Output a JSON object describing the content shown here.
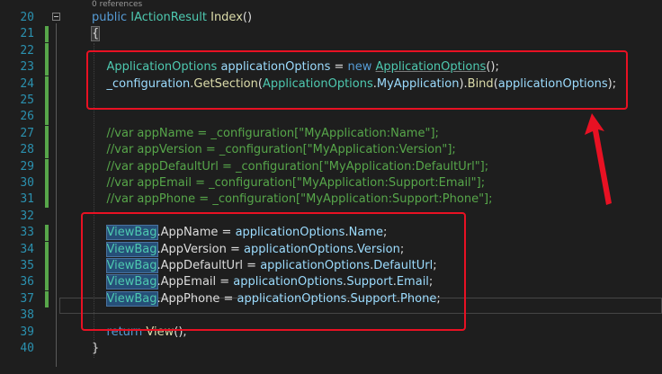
{
  "refs": "0 references",
  "lines": [
    {
      "n": "20",
      "parts": [
        [
          "kw",
          "public "
        ],
        [
          "ty",
          "IActionResult "
        ],
        [
          "fn",
          "Index"
        ],
        [
          "plain",
          "()"
        ]
      ]
    },
    {
      "n": "21",
      "parts": [
        [
          "brace",
          "{"
        ]
      ]
    },
    {
      "n": "22",
      "parts": []
    },
    {
      "n": "23",
      "parts": [
        [
          "plain",
          "    "
        ],
        [
          "ty",
          "ApplicationOptions "
        ],
        [
          "var",
          "applicationOptions"
        ],
        [
          "plain",
          " = "
        ],
        [
          "kw",
          "new "
        ],
        [
          "tyu",
          "ApplicationOptions"
        ],
        [
          "plain",
          "();"
        ]
      ]
    },
    {
      "n": "24",
      "parts": [
        [
          "plain",
          "    "
        ],
        [
          "var",
          "_configuration"
        ],
        [
          "plain",
          "."
        ],
        [
          "fn",
          "GetSection"
        ],
        [
          "plain",
          "("
        ],
        [
          "ty",
          "ApplicationOptions"
        ],
        [
          "plain",
          "."
        ],
        [
          "var",
          "MyApplication"
        ],
        [
          "plain",
          ")."
        ],
        [
          "fn",
          "Bind"
        ],
        [
          "plain",
          "("
        ],
        [
          "var",
          "applicationOptions"
        ],
        [
          "plain",
          ");"
        ]
      ]
    },
    {
      "n": "25",
      "parts": []
    },
    {
      "n": "26",
      "parts": []
    },
    {
      "n": "27",
      "parts": [
        [
          "plain",
          "    "
        ],
        [
          "cm",
          "//var appName = _configuration[\"MyApplication:Name\"];"
        ]
      ]
    },
    {
      "n": "28",
      "parts": [
        [
          "plain",
          "    "
        ],
        [
          "cm",
          "//var appVersion = _configuration[\"MyApplication:Version\"];"
        ]
      ]
    },
    {
      "n": "29",
      "parts": [
        [
          "plain",
          "    "
        ],
        [
          "cm",
          "//var appDefaultUrl = _configuration[\"MyApplication:DefaultUrl\"];"
        ]
      ]
    },
    {
      "n": "30",
      "parts": [
        [
          "plain",
          "    "
        ],
        [
          "cm",
          "//var appEmail = _configuration[\"MyApplication:Support:Email\"];"
        ]
      ]
    },
    {
      "n": "31",
      "parts": [
        [
          "plain",
          "    "
        ],
        [
          "cm",
          "//var appPhone = _configuration[\"MyApplication:Support:Phone\"];"
        ]
      ]
    },
    {
      "n": "32",
      "parts": []
    },
    {
      "n": "33",
      "parts": [
        [
          "plain",
          "    "
        ],
        [
          "hl",
          "ViewBag"
        ],
        [
          "plain",
          ".AppName = "
        ],
        [
          "var",
          "applicationOptions"
        ],
        [
          "plain",
          "."
        ],
        [
          "var",
          "Name"
        ],
        [
          "plain",
          ";"
        ]
      ]
    },
    {
      "n": "34",
      "parts": [
        [
          "plain",
          "    "
        ],
        [
          "hl",
          "ViewBag"
        ],
        [
          "plain",
          ".AppVersion = "
        ],
        [
          "var",
          "applicationOptions"
        ],
        [
          "plain",
          "."
        ],
        [
          "var",
          "Version"
        ],
        [
          "plain",
          ";"
        ]
      ]
    },
    {
      "n": "35",
      "parts": [
        [
          "plain",
          "    "
        ],
        [
          "hl",
          "ViewBag"
        ],
        [
          "plain",
          ".AppDefaultUrl = "
        ],
        [
          "var",
          "applicationOptions"
        ],
        [
          "plain",
          "."
        ],
        [
          "var",
          "DefaultUrl"
        ],
        [
          "plain",
          ";"
        ]
      ]
    },
    {
      "n": "36",
      "parts": [
        [
          "plain",
          "    "
        ],
        [
          "hl",
          "ViewBag"
        ],
        [
          "plain",
          ".AppEmail = "
        ],
        [
          "var",
          "applicationOptions"
        ],
        [
          "plain",
          "."
        ],
        [
          "var",
          "Support"
        ],
        [
          "plain",
          "."
        ],
        [
          "var",
          "Email"
        ],
        [
          "plain",
          ";"
        ]
      ]
    },
    {
      "n": "37",
      "parts": [
        [
          "plain",
          "    "
        ],
        [
          "hl",
          "ViewBag"
        ],
        [
          "plain",
          ".AppPhone = "
        ],
        [
          "var",
          "applicationOptions"
        ],
        [
          "plain",
          "."
        ],
        [
          "var",
          "Support"
        ],
        [
          "plain",
          "."
        ],
        [
          "var",
          "Phone"
        ],
        [
          "plain",
          ";"
        ]
      ]
    },
    {
      "n": "38",
      "parts": []
    },
    {
      "n": "39",
      "parts": [
        [
          "plain",
          "    "
        ],
        [
          "kw",
          "return "
        ],
        [
          "fn",
          "View"
        ],
        [
          "plain",
          "();"
        ]
      ]
    },
    {
      "n": "40",
      "parts": [
        [
          "plain",
          "}"
        ]
      ]
    }
  ],
  "modified_lines": [
    "21",
    "22",
    "23",
    "24",
    "25",
    "26",
    "27",
    "28",
    "29",
    "30",
    "31",
    "33",
    "34",
    "35",
    "36",
    "37"
  ],
  "current_line": "37",
  "colors": {
    "background": "#1e1e1e",
    "line_number": "#2b91af",
    "keyword": "#569cd6",
    "type": "#4ec9b0",
    "method": "#dcdcaa",
    "identifier": "#9cdcfe",
    "comment": "#57a64a",
    "annotation": "#e81123"
  },
  "annotations": [
    "red-box-section-1",
    "red-box-section-2",
    "red-arrow"
  ]
}
